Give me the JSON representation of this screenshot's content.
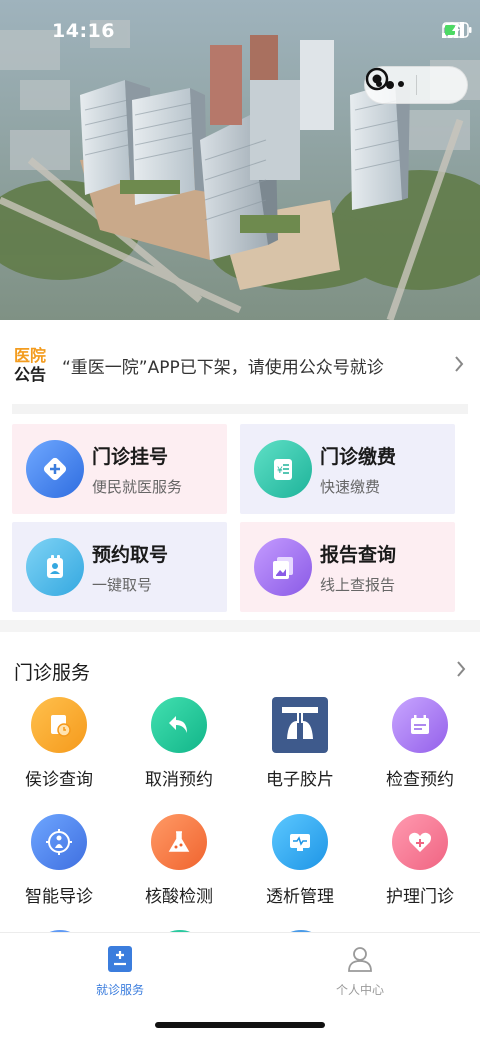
{
  "status_bar": {
    "time": "14:16"
  },
  "notice": {
    "badge_line1": "医院",
    "badge_line2": "公告",
    "text": "“重医一院”APP已下架，请使用公众号就诊"
  },
  "quick_cards": [
    {
      "title": "门诊挂号",
      "subtitle": "便民就医服务",
      "icon": "register-icon"
    },
    {
      "title": "门诊缴费",
      "subtitle": "快速缴费",
      "icon": "payment-icon"
    },
    {
      "title": "预约取号",
      "subtitle": "一键取号",
      "icon": "ticket-icon"
    },
    {
      "title": "报告查询",
      "subtitle": "线上查报告",
      "icon": "report-icon"
    }
  ],
  "services": {
    "title": "门诊服务",
    "items": [
      {
        "label": "侯诊查询",
        "icon": "queue-clock-icon"
      },
      {
        "label": "取消预约",
        "icon": "undo-arrow-icon"
      },
      {
        "label": "电子胶片",
        "icon": "lungs-film-icon"
      },
      {
        "label": "检查预约",
        "icon": "calendar-icon"
      },
      {
        "label": "智能导诊",
        "icon": "compass-person-icon"
      },
      {
        "label": "核酸检测",
        "icon": "flask-icon"
      },
      {
        "label": "透析管理",
        "icon": "monitor-icon"
      },
      {
        "label": "护理门诊",
        "icon": "heart-plus-icon"
      }
    ]
  },
  "tabbar": {
    "items": [
      {
        "label": "就诊服务",
        "icon": "clipboard-plus-icon",
        "active": true
      },
      {
        "label": "个人中心",
        "icon": "person-icon",
        "active": false
      }
    ]
  },
  "colors": {
    "accent_blue": "#3b7ddd",
    "notice_orange": "#f39c1f",
    "card_pink": "#fdeef2",
    "card_lavender": "#efeffa"
  }
}
